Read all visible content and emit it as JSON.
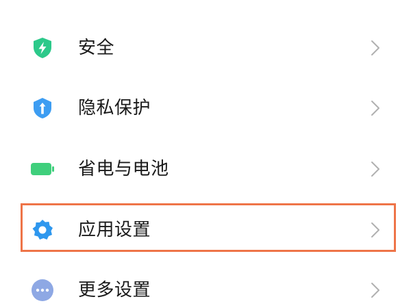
{
  "settings": {
    "items": [
      {
        "label": "安全",
        "icon": "shield-lightning-icon",
        "icon_color": "#2cc98a"
      },
      {
        "label": "隐私保护",
        "icon": "privacy-shield-icon",
        "icon_color": "#3d9df2"
      },
      {
        "label": "省电与电池",
        "icon": "battery-icon",
        "icon_color": "#3fcf7c"
      },
      {
        "label": "应用设置",
        "icon": "gear-icon",
        "icon_color": "#2e97ee"
      },
      {
        "label": "更多设置",
        "icon": "more-dots-icon",
        "icon_color": "#8ea8e4"
      }
    ],
    "highlighted_item": "应用设置",
    "highlight_color": "#ee7448",
    "chevron_color": "#b0b0b0"
  }
}
